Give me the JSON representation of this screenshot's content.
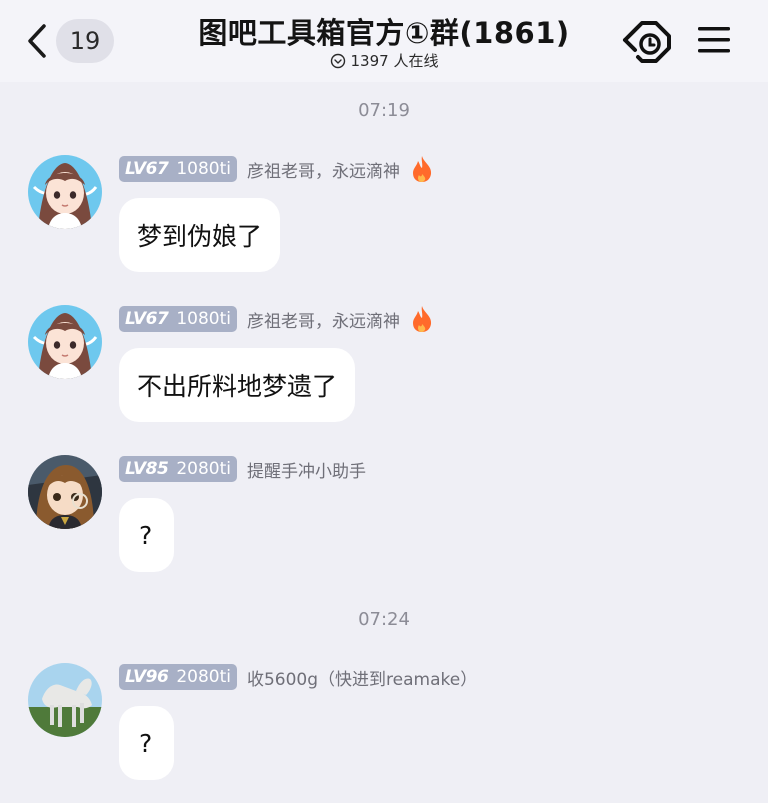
{
  "header": {
    "back_count": "19",
    "title": "图吧工具箱官方①群(1861)",
    "online": "1397 人在线"
  },
  "timestamps": [
    "07:19",
    "07:24"
  ],
  "messages": [
    {
      "level": "LV67",
      "title": "1080ti",
      "nick": "彦祖老哥，永远滴神",
      "text": "梦到伪娘了",
      "avatar": "anime-girl-avatar",
      "flame": true
    },
    {
      "level": "LV67",
      "title": "1080ti",
      "nick": "彦祖老哥，永远滴神",
      "text": "不出所料地梦遗了",
      "avatar": "anime-girl-avatar",
      "flame": true
    },
    {
      "level": "LV85",
      "title": "2080ti",
      "nick": "提醒手冲小助手",
      "text": "?",
      "avatar": "anime-character-avatar",
      "flame": false
    },
    {
      "level": "LV96",
      "title": "2080ti",
      "nick": "收5600g（快进到reamake）",
      "text": "?",
      "avatar": "horse-avatar",
      "flame": false
    }
  ],
  "colors": {
    "background": "#efeff5",
    "badge": "#a8b0c6",
    "bubble": "#ffffff",
    "meta_text": "#6f6f78"
  }
}
